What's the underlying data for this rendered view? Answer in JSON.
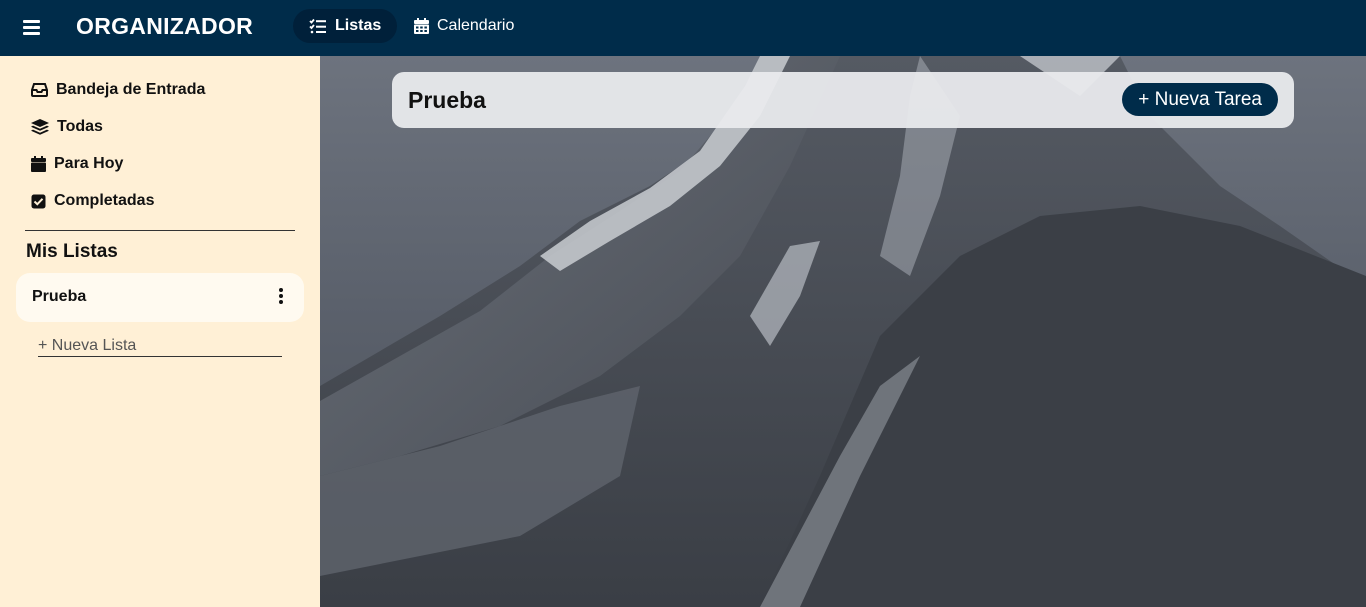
{
  "app": {
    "brand": "ORGANIZADOR",
    "menu_icon": "hamburger-menu-icon"
  },
  "nav": {
    "tabs": [
      {
        "label": "Listas",
        "icon": "checklist-icon",
        "active": true
      },
      {
        "label": "Calendario",
        "icon": "calendar-icon",
        "active": false
      }
    ]
  },
  "sidebar": {
    "items": [
      {
        "label": "Bandeja de Entrada",
        "icon": "inbox-icon"
      },
      {
        "label": "Todas",
        "icon": "layers-icon"
      },
      {
        "label": "Para Hoy",
        "icon": "calendar-today-icon"
      },
      {
        "label": "Completadas",
        "icon": "check-square-icon"
      }
    ],
    "section_title": "Mis Listas",
    "lists": [
      {
        "name": "Prueba",
        "menu_icon": "kebab-menu-icon"
      }
    ],
    "new_list_placeholder": "+ Nueva Lista"
  },
  "main": {
    "list_title": "Prueba",
    "new_task_label": "+ Nueva Tarea",
    "background": "mountain-photo"
  },
  "colors": {
    "navbar": "#002c4a",
    "active_tab": "#00203a",
    "sidebar": "#fff0d6",
    "list_card": "#fffaf0",
    "header_card": "#e9eaed",
    "button": "#002c4a"
  }
}
